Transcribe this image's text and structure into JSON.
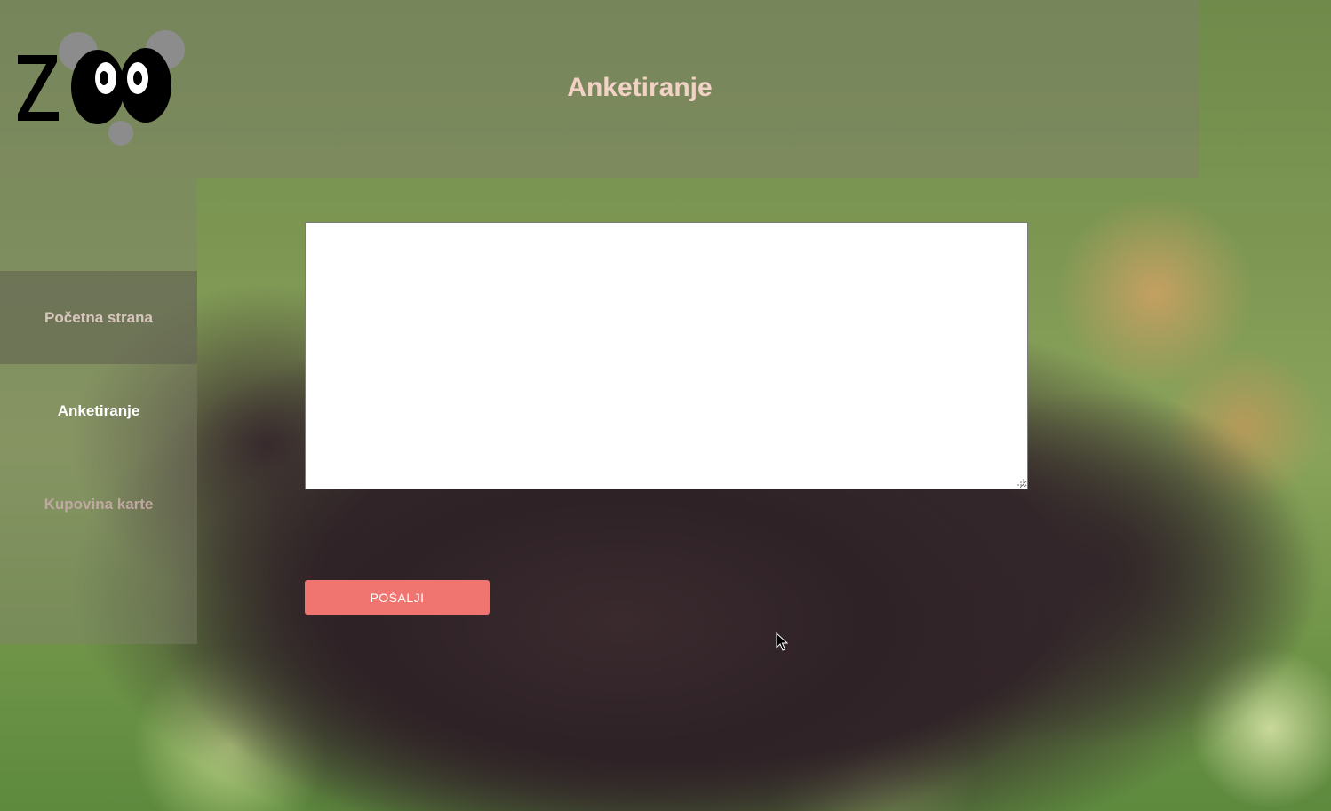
{
  "header": {
    "logo_text": "ZOO",
    "title": "Anketiranje"
  },
  "sidebar": {
    "items": [
      {
        "label": "Početna strana",
        "active": false
      },
      {
        "label": "Anketiranje",
        "active": true
      },
      {
        "label": "Kupovina karte",
        "active": false
      }
    ]
  },
  "main": {
    "survey_text": "",
    "submit_label": "POŠALJI"
  },
  "colors": {
    "title": "#f3d2c6",
    "button": "#f07470",
    "active_nav": "#ffffff"
  }
}
